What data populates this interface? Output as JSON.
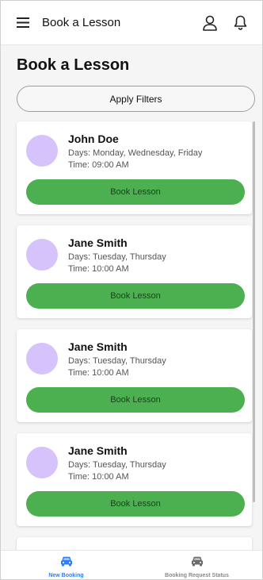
{
  "header": {
    "title": "Book a Lesson",
    "menu_icon": "hamburger-menu-icon",
    "profile_icon": "person-icon",
    "bell_icon": "bell-icon"
  },
  "page": {
    "title": "Book a Lesson",
    "filter_label": "Apply Filters"
  },
  "lessons": [
    {
      "name": "John Doe",
      "days": "Days: Monday, Wednesday, Friday",
      "time": "Time: 09:00 AM",
      "button": "Book Lesson"
    },
    {
      "name": "Jane Smith",
      "days": "Days: Tuesday, Thursday",
      "time": "Time: 10:00 AM",
      "button": "Book Lesson"
    },
    {
      "name": "Jane Smith",
      "days": "Days: Tuesday, Thursday",
      "time": "Time: 10:00 AM",
      "button": "Book Lesson"
    },
    {
      "name": "Jane Smith",
      "days": "Days: Tuesday, Thursday",
      "time": "Time: 10:00 AM",
      "button": "Book Lesson"
    }
  ],
  "bottom_nav": {
    "items": [
      {
        "label": "New Booking",
        "icon": "car-icon",
        "active": true
      },
      {
        "label": "Booking Request Status",
        "icon": "car-icon",
        "active": false
      }
    ]
  },
  "colors": {
    "accent_green": "#4caf50",
    "avatar_purple": "#d6c3fb",
    "active_blue": "#2f80ed",
    "inactive_gray": "#8a8a8a"
  }
}
